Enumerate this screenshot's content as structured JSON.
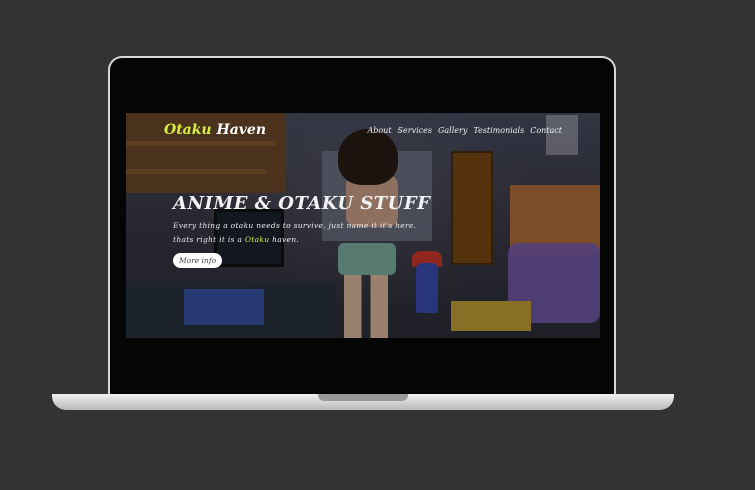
{
  "brand": {
    "part1": "Otaku",
    "part2": "Haven",
    "accent_color": "#d6f23a"
  },
  "nav": {
    "items": [
      "About",
      "Services",
      "Gallery",
      "Testimonials",
      "Contact"
    ]
  },
  "hero": {
    "title": "ANIME & OTAKU STUFF",
    "line1": "Every thing a otaku needs to survive, just name it it's here.",
    "line2_before": "thats right it is a",
    "line2_accent": "Otaku",
    "line2_after": "haven.",
    "button_label": "More info"
  },
  "colors": {
    "background": "#333333",
    "laptop_frame": "#d8d8d8",
    "screen_bezel": "#050505"
  }
}
